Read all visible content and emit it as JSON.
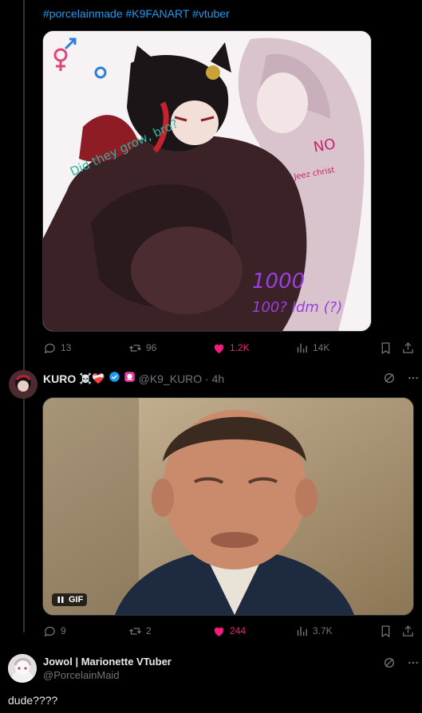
{
  "tweet1": {
    "hashtags": "#porcelainmade #K9FANART #vtuber",
    "art_text": {
      "did_they": "Did they grow, bro?",
      "no": "NO",
      "jeez": "Jeez christ",
      "count": "1000",
      "reply": "100? Idm (?)"
    },
    "actions": {
      "replies": "13",
      "reposts": "96",
      "likes": "1.2K",
      "views": "14K"
    }
  },
  "tweet2": {
    "author_name": "KURO",
    "author_emoji": "☠️❤️‍🩹",
    "handle_time": "@K9_KURO · 4h",
    "gif_label": "GIF",
    "actions": {
      "replies": "9",
      "reposts": "2",
      "likes": "244",
      "views": "3.7K"
    }
  },
  "reply": {
    "author_name": "Jowol | Marionette VTuber",
    "handle": "@PorcelainMaid",
    "text": "dude????"
  },
  "colors": {
    "accent": "#1d9bf0",
    "like": "#f91880",
    "muted": "#71767b",
    "verified": "#1d9bf0"
  }
}
